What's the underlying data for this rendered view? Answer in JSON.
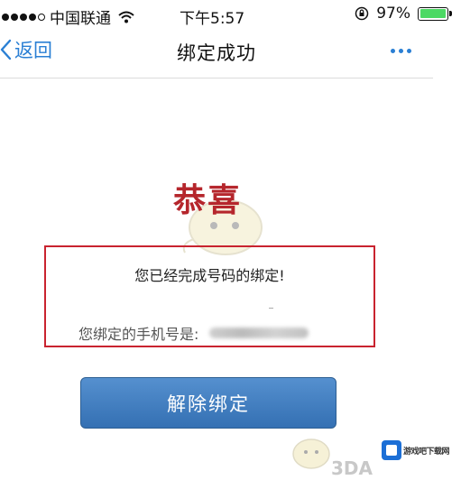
{
  "status_bar": {
    "carrier": "中国联通",
    "time": "下午5:57",
    "battery_percent": "97%",
    "battery_level": 0.97,
    "icons": [
      "signal-dots-icon",
      "wifi-icon",
      "orientation-lock-icon",
      "battery-icon"
    ]
  },
  "nav": {
    "back_label": "返回",
    "title": "绑定成功",
    "more_icon": "more-dots-icon"
  },
  "main": {
    "congrats": "恭喜",
    "success_message": "您已经完成号码的绑定!",
    "phone_label": "您绑定的手机号是:",
    "unbind_button": "解除绑定"
  },
  "watermark": {
    "text": "3DA",
    "site_text": "游戏吧下载网"
  },
  "colors": {
    "accent": "#2a7fd4",
    "button": "#3f7cc0",
    "highlight_border": "#c9232f",
    "congrats": "#b5262c",
    "battery": "#4cd964"
  }
}
